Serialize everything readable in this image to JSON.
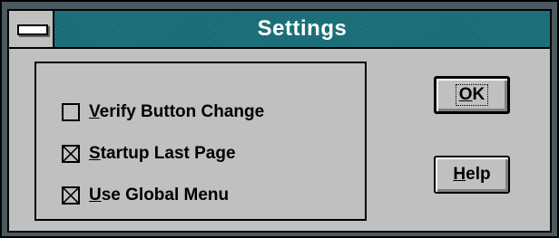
{
  "window": {
    "title": "Settings"
  },
  "options": [
    {
      "mnemonic": "V",
      "rest": "erify Button Change",
      "checked": false
    },
    {
      "mnemonic": "S",
      "rest": "tartup Last Page",
      "checked": true
    },
    {
      "mnemonic": "U",
      "rest": "se Global Menu",
      "checked": true
    }
  ],
  "buttons": {
    "ok": {
      "mnemonic": "O",
      "rest": "K"
    },
    "help": {
      "mnemonic": "H",
      "rest": "elp"
    }
  },
  "colors": {
    "title_bar": "#18707a",
    "frame": "#4a5a60",
    "face": "#c0c0c0"
  },
  "icons": {
    "system_menu": "system-menu-icon",
    "check_mark": "x-check-icon"
  }
}
